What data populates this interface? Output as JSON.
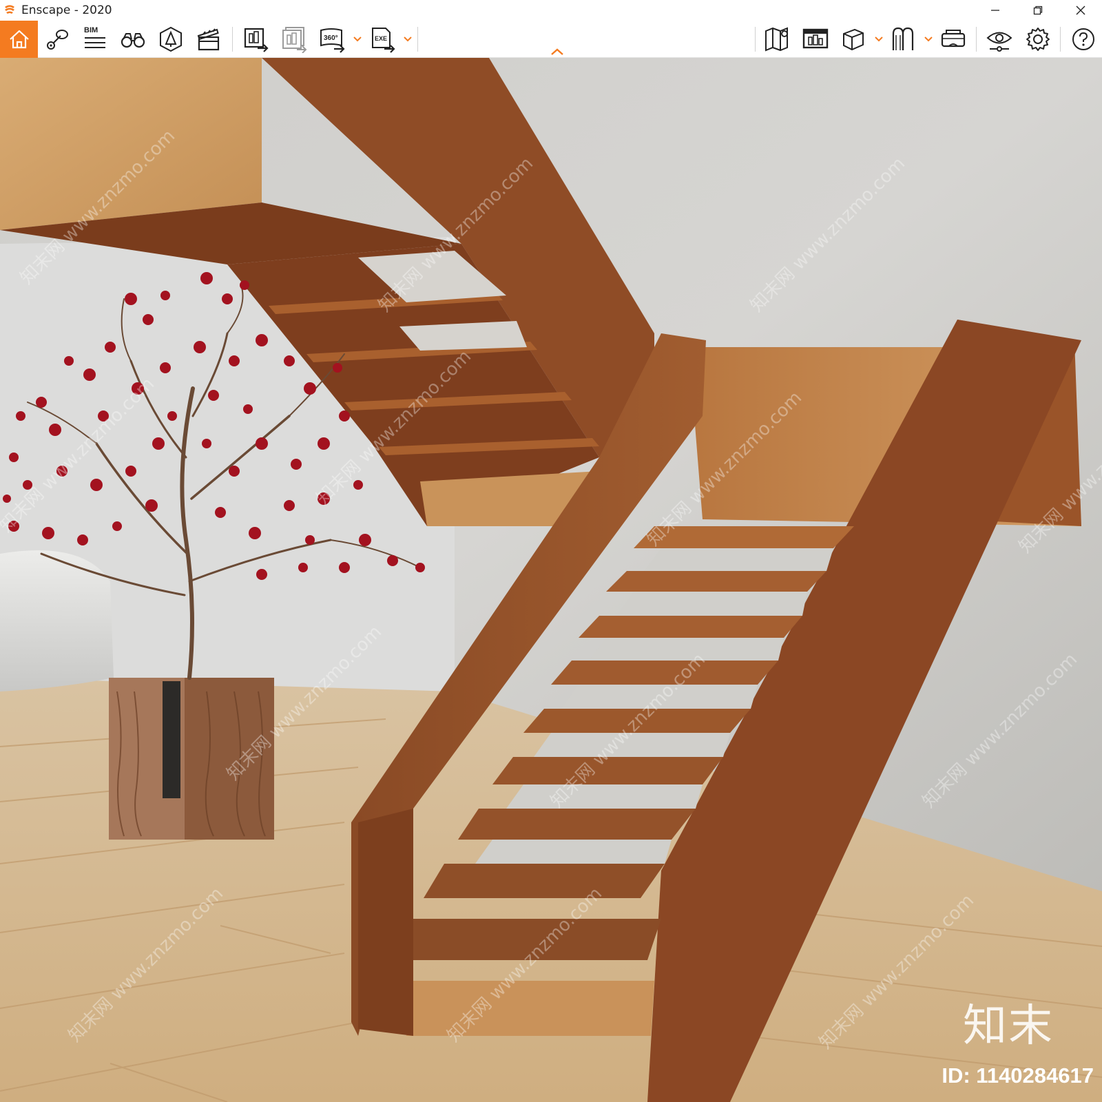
{
  "window": {
    "title": "Enscape - 2020"
  },
  "toolbar": {
    "bim_label": "BIM",
    "badge_360": "360°",
    "badge_exe": "EXE",
    "items": [
      {
        "name": "home-icon"
      },
      {
        "name": "location-pin-icon"
      },
      {
        "name": "bim-info-icon"
      },
      {
        "name": "binoculars-icon"
      },
      {
        "name": "asset-library-icon"
      },
      {
        "name": "video-editor-icon"
      },
      {
        "name": "render-screenshot-icon"
      },
      {
        "name": "batch-render-icon"
      },
      {
        "name": "export-360-icon"
      },
      {
        "name": "export-exe-icon"
      },
      {
        "name": "map-view-icon"
      },
      {
        "name": "views-icon"
      },
      {
        "name": "cube-icon"
      },
      {
        "name": "material-editor-icon"
      },
      {
        "name": "vr-headset-icon"
      },
      {
        "name": "visual-settings-icon"
      },
      {
        "name": "gear-icon"
      },
      {
        "name": "help-icon"
      }
    ],
    "accent_color": "#f47b20"
  },
  "watermark": {
    "logo_text": "知末",
    "id_text": "ID: 1140284617",
    "diagonal_text": "知末网 www.znzmo.com"
  }
}
